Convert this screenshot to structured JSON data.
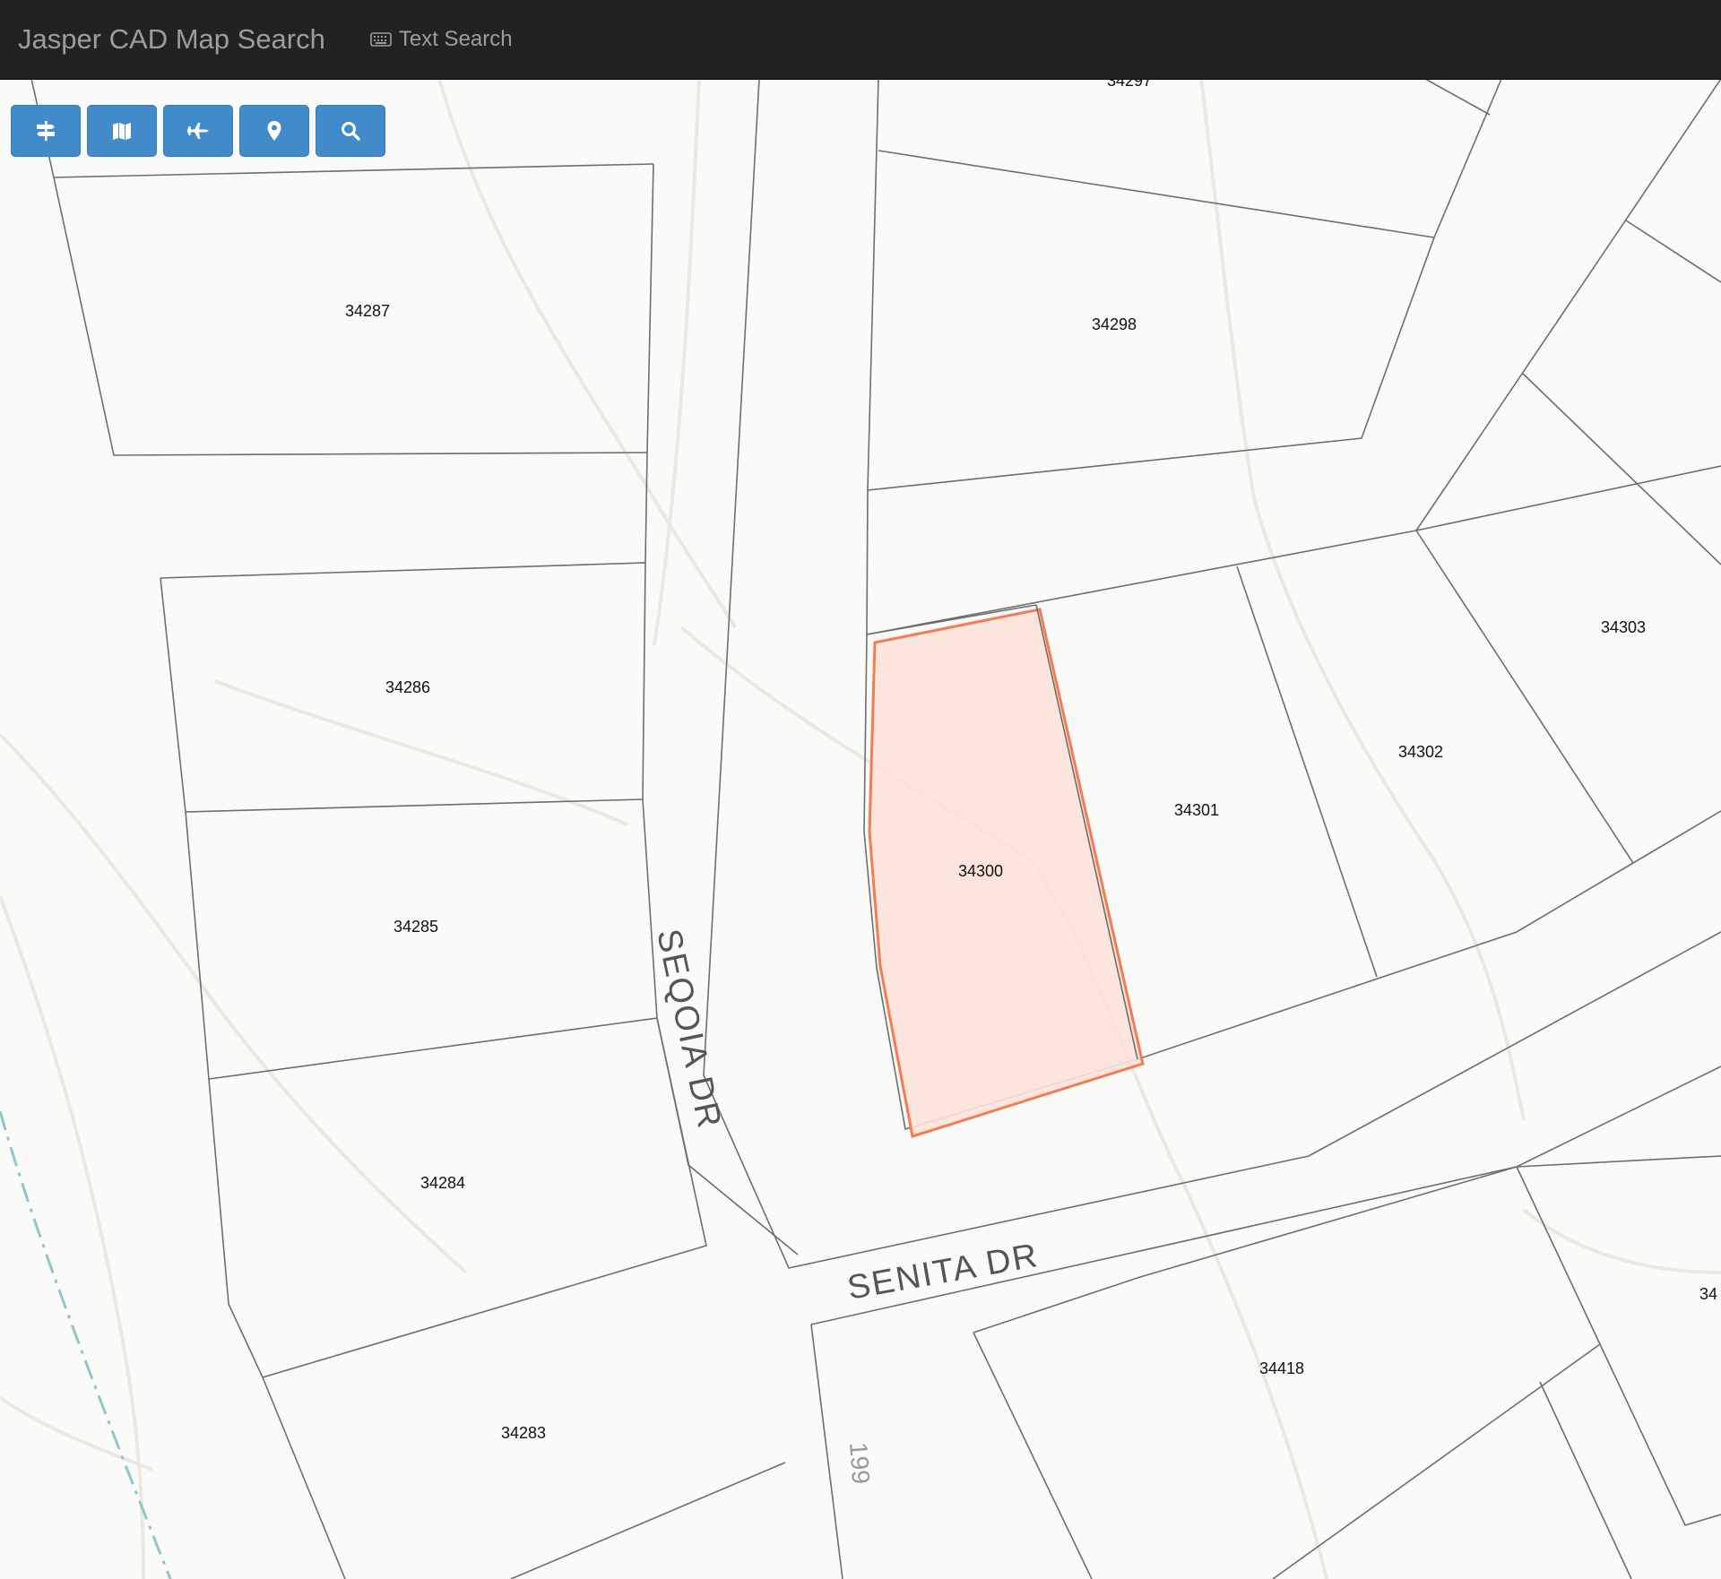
{
  "navbar": {
    "brand": "Jasper CAD Map Search",
    "text_search_label": "Text Search"
  },
  "toolbar": {
    "buttons": [
      {
        "name": "layers-toggle-button",
        "icon": "road-sign-icon"
      },
      {
        "name": "basemap-button",
        "icon": "map-icon"
      },
      {
        "name": "aerial-button",
        "icon": "airplane-icon"
      },
      {
        "name": "locate-button",
        "icon": "map-marker-icon"
      },
      {
        "name": "search-button",
        "icon": "search-icon"
      }
    ]
  },
  "map": {
    "selected_color": "#f47c52",
    "selected_fill": "#fbe2d8",
    "parcels": [
      {
        "id": "p-34297",
        "label": "34297"
      },
      {
        "id": "p-34287",
        "label": "34287"
      },
      {
        "id": "p-34298",
        "label": "34298"
      },
      {
        "id": "p-34286",
        "label": "34286"
      },
      {
        "id": "p-34303",
        "label": "34303"
      },
      {
        "id": "p-34302",
        "label": "34302"
      },
      {
        "id": "p-34301",
        "label": "34301"
      },
      {
        "id": "p-34300",
        "label": "34300"
      },
      {
        "id": "p-34285",
        "label": "34285"
      },
      {
        "id": "p-34284",
        "label": "34284"
      },
      {
        "id": "p-34418",
        "label": "34418"
      },
      {
        "id": "p-34283",
        "label": "34283"
      },
      {
        "id": "p-34-edge",
        "label": "34"
      }
    ],
    "roads": {
      "sequoia": "SEQOIA DR",
      "senita": "SENITA DR",
      "highway": "199"
    }
  }
}
